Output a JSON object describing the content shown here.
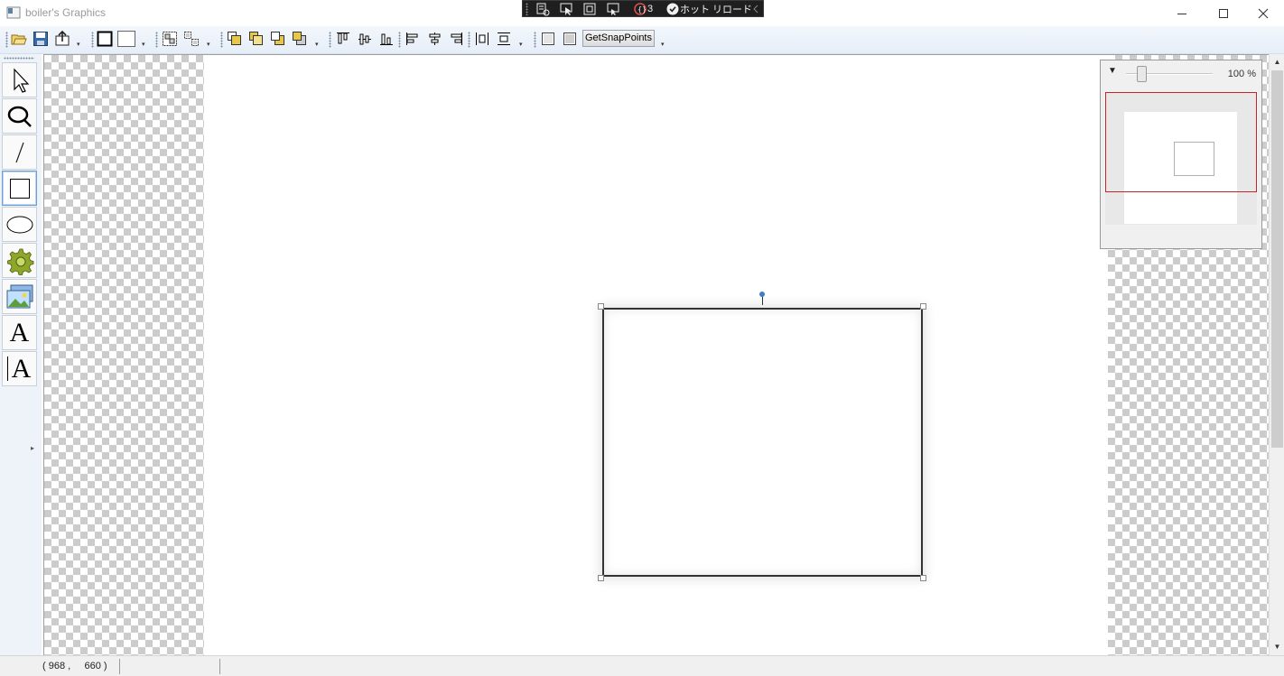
{
  "window": {
    "title": "boiler's Graphics",
    "icons": {
      "app": "app-window-icon",
      "minimize": "minimize-icon",
      "maximize": "maximize-icon",
      "close": "close-icon"
    }
  },
  "debug_toolbar": {
    "error_count": "3",
    "hot_reload_label": "ホット リロード",
    "icons": [
      "live-visual-tree-icon",
      "select-element-icon",
      "display-layout-adorners-icon",
      "track-focus-icon",
      "binding-failures-icon",
      "hot-reload-check-icon",
      "collapse-chevron-icon"
    ]
  },
  "toolbar": {
    "file_buttons": [
      "open-file-icon",
      "save-file-icon",
      "export-icon"
    ],
    "style_buttons": [
      "stroke-style-icon",
      "fill-style-icon"
    ],
    "group_buttons": [
      "group-icon",
      "ungroup-icon"
    ],
    "order_buttons": [
      "bring-to-front-icon",
      "bring-forward-icon",
      "send-backward-icon",
      "send-to-back-icon"
    ],
    "align_buttons": [
      "align-top-icon",
      "align-middle-icon",
      "align-bottom-icon",
      "align-left-icon",
      "align-center-icon",
      "align-right-icon",
      "distribute-horizontal-icon",
      "distribute-vertical-icon"
    ],
    "view_buttons": [
      "page-view-icon",
      "grid-view-icon"
    ],
    "snap_button_label": "GetSnapPoints"
  },
  "palette": {
    "tools": [
      {
        "name": "pointer-tool",
        "icon": "arrow-cursor-icon"
      },
      {
        "name": "zoom-tool",
        "icon": "magnifier-icon"
      },
      {
        "name": "line-tool",
        "icon": "line-icon"
      },
      {
        "name": "rectangle-tool",
        "icon": "rectangle-icon",
        "selected": true
      },
      {
        "name": "ellipse-tool",
        "icon": "ellipse-icon"
      },
      {
        "name": "settings-tool",
        "icon": "gear-icon"
      },
      {
        "name": "image-tool",
        "icon": "picture-icon"
      },
      {
        "name": "text-tool",
        "label": "A"
      },
      {
        "name": "textbox-tool",
        "label": "A"
      }
    ]
  },
  "navigator": {
    "zoom_label": "100 %",
    "zoom_value": 100
  },
  "status": {
    "coords": "( 968 ,     660 )"
  }
}
